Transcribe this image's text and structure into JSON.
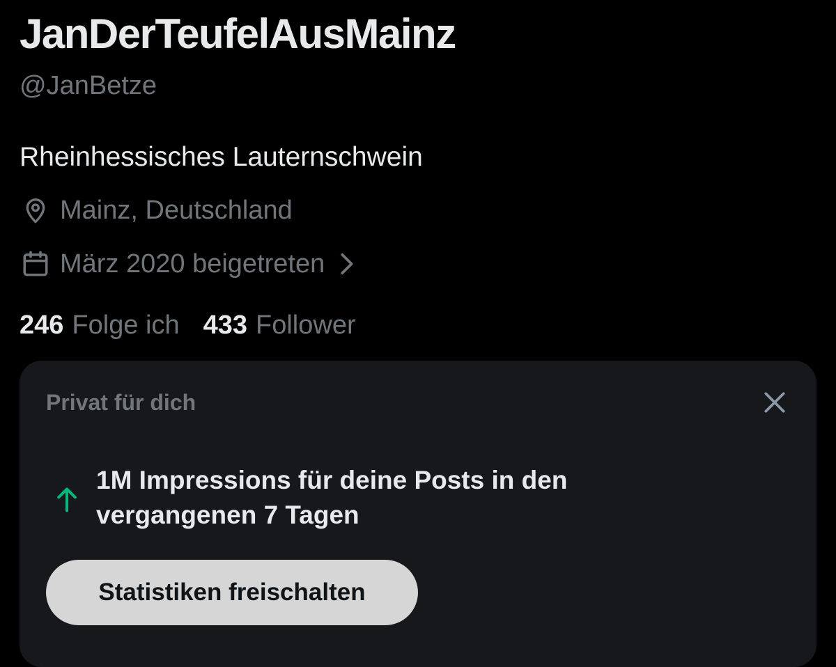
{
  "profile": {
    "display_name": "JanDerTeufelAusMainz",
    "handle": "@JanBetze",
    "bio": "Rheinhessisches Lauternschwein",
    "location": {
      "icon": "location-pin-icon",
      "text": "Mainz, Deutschland"
    },
    "joined": {
      "icon": "calendar-icon",
      "text": "März 2020 beigetreten",
      "chevron_icon": "chevron-right-icon"
    },
    "following": {
      "count": "246",
      "label": "Folge ich"
    },
    "followers": {
      "count": "433",
      "label": "Follower"
    }
  },
  "private_card": {
    "header": "Privat für dich",
    "close_icon": "close-icon",
    "stat_icon": "arrow-up-icon",
    "stat_text": "1M Impressions für deine Posts in den vergangenen 7 Tagen",
    "button_label": "Statistiken freischalten"
  },
  "colors": {
    "background": "#000000",
    "primary_text": "#e7e9ea",
    "secondary_text": "#71767b",
    "card_background": "#16181c",
    "accent_green": "#00ba7c",
    "button_background": "#d6d6d6",
    "button_text": "#0f1419"
  }
}
